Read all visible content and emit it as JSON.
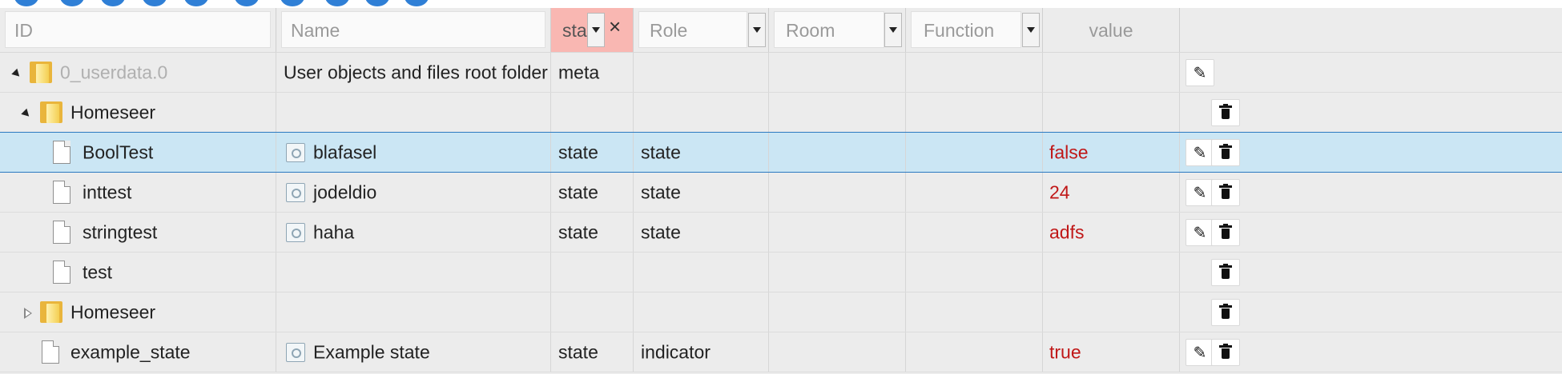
{
  "columns": {
    "id": "ID",
    "name": "Name",
    "type": "sta",
    "role": "Role",
    "room": "Room",
    "function": "Function",
    "value": "value",
    "clear_filter": "×"
  },
  "rows": [
    {
      "id": "0_userdata.0",
      "name": "User objects and files root folder",
      "type": "meta",
      "role": "",
      "value": ""
    },
    {
      "id": "Homeseer",
      "name": "",
      "type": "",
      "role": "",
      "value": ""
    },
    {
      "id": "BoolTest",
      "name": "blafasel",
      "type": "state",
      "role": "state",
      "value": "false"
    },
    {
      "id": "inttest",
      "name": "jodeldio",
      "type": "state",
      "role": "state",
      "value": "24"
    },
    {
      "id": "stringtest",
      "name": "haha",
      "type": "state",
      "role": "state",
      "value": "adfs"
    },
    {
      "id": "test",
      "name": "",
      "type": "",
      "role": "",
      "value": ""
    },
    {
      "id": "Homeseer",
      "name": "",
      "type": "",
      "role": "",
      "value": ""
    },
    {
      "id": "example_state",
      "name": "Example state",
      "type": "state",
      "role": "indicator",
      "value": "true"
    }
  ],
  "icons": {
    "edit": "✎",
    "delete": "trash"
  },
  "colors": {
    "selected_row": "#cbe6f4",
    "active_filter": "#f9b7b2",
    "value_text": "#c01717"
  }
}
